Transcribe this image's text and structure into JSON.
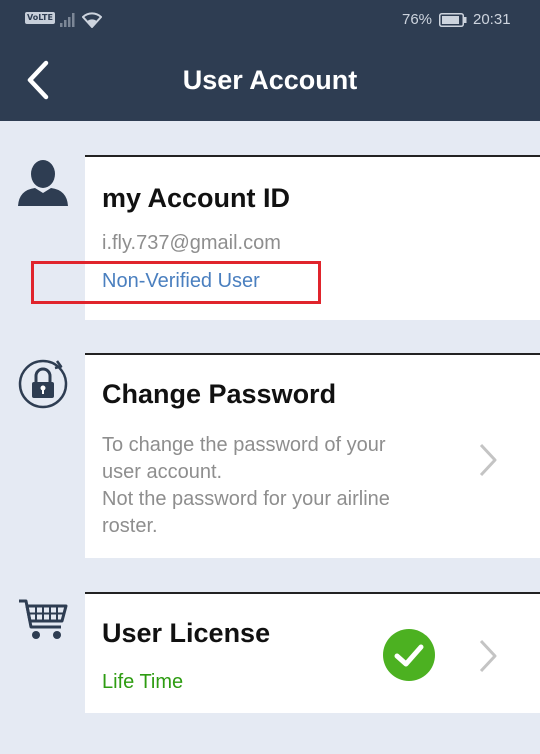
{
  "status_bar": {
    "network": "VoLTE",
    "battery": "76%",
    "time": "20:31"
  },
  "header": {
    "title": "User Account"
  },
  "account": {
    "title": "my Account ID",
    "email": "i.fly.737@gmail.com",
    "status": "Non-Verified User"
  },
  "change_password": {
    "title": "Change Password",
    "description_line1": "To change the password of your",
    "description_line2": "user account.",
    "description_line3": "Not the password for your airline",
    "description_line4": "roster."
  },
  "license": {
    "title": "User License",
    "value": "Life Time",
    "verified": true
  },
  "colors": {
    "header_bg": "#2e3d52",
    "page_bg": "#e5eaf3",
    "link_blue": "#4a7fbf",
    "license_green": "#2e9c12",
    "check_green": "#4cb121",
    "highlight_red": "#e0242c"
  }
}
